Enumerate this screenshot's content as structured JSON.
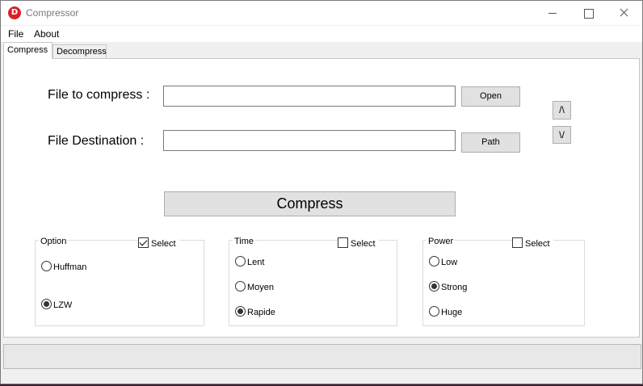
{
  "window": {
    "title": "Compressor"
  },
  "menu": {
    "file": "File",
    "about": "About"
  },
  "tabs": {
    "compress": "Compress",
    "decompress": "Decompress"
  },
  "compress": {
    "file_label": "File to compress :",
    "file_value": "",
    "open_button": "Open",
    "dest_label": "File Destination :",
    "dest_value": "",
    "path_button": "Path",
    "up_button": "/\\",
    "down_button": "\\/",
    "compress_button": "Compress"
  },
  "groups": {
    "option": {
      "title": "Option",
      "select_label": "Select",
      "select_checked": true,
      "radios": [
        {
          "label": "Huffman",
          "checked": false
        },
        {
          "label": "LZW",
          "checked": true
        }
      ]
    },
    "time": {
      "title": "Time",
      "select_label": "Select",
      "select_checked": false,
      "radios": [
        {
          "label": "Lent",
          "checked": false
        },
        {
          "label": "Moyen",
          "checked": false
        },
        {
          "label": "Rapide",
          "checked": true
        }
      ]
    },
    "power": {
      "title": "Power",
      "select_label": "Select",
      "select_checked": false,
      "radios": [
        {
          "label": "Low",
          "checked": false
        },
        {
          "label": "Strong",
          "checked": true
        },
        {
          "label": "Huge",
          "checked": false
        }
      ]
    }
  },
  "icons": {
    "app": "compressor-app-icon",
    "minimize": "minimize-icon",
    "maximize": "maximize-icon",
    "close": "close-icon"
  },
  "colors": {
    "app_icon": "#d6212b",
    "window_bg": "#f0f0f0",
    "button_bg": "#e1e1e1"
  }
}
